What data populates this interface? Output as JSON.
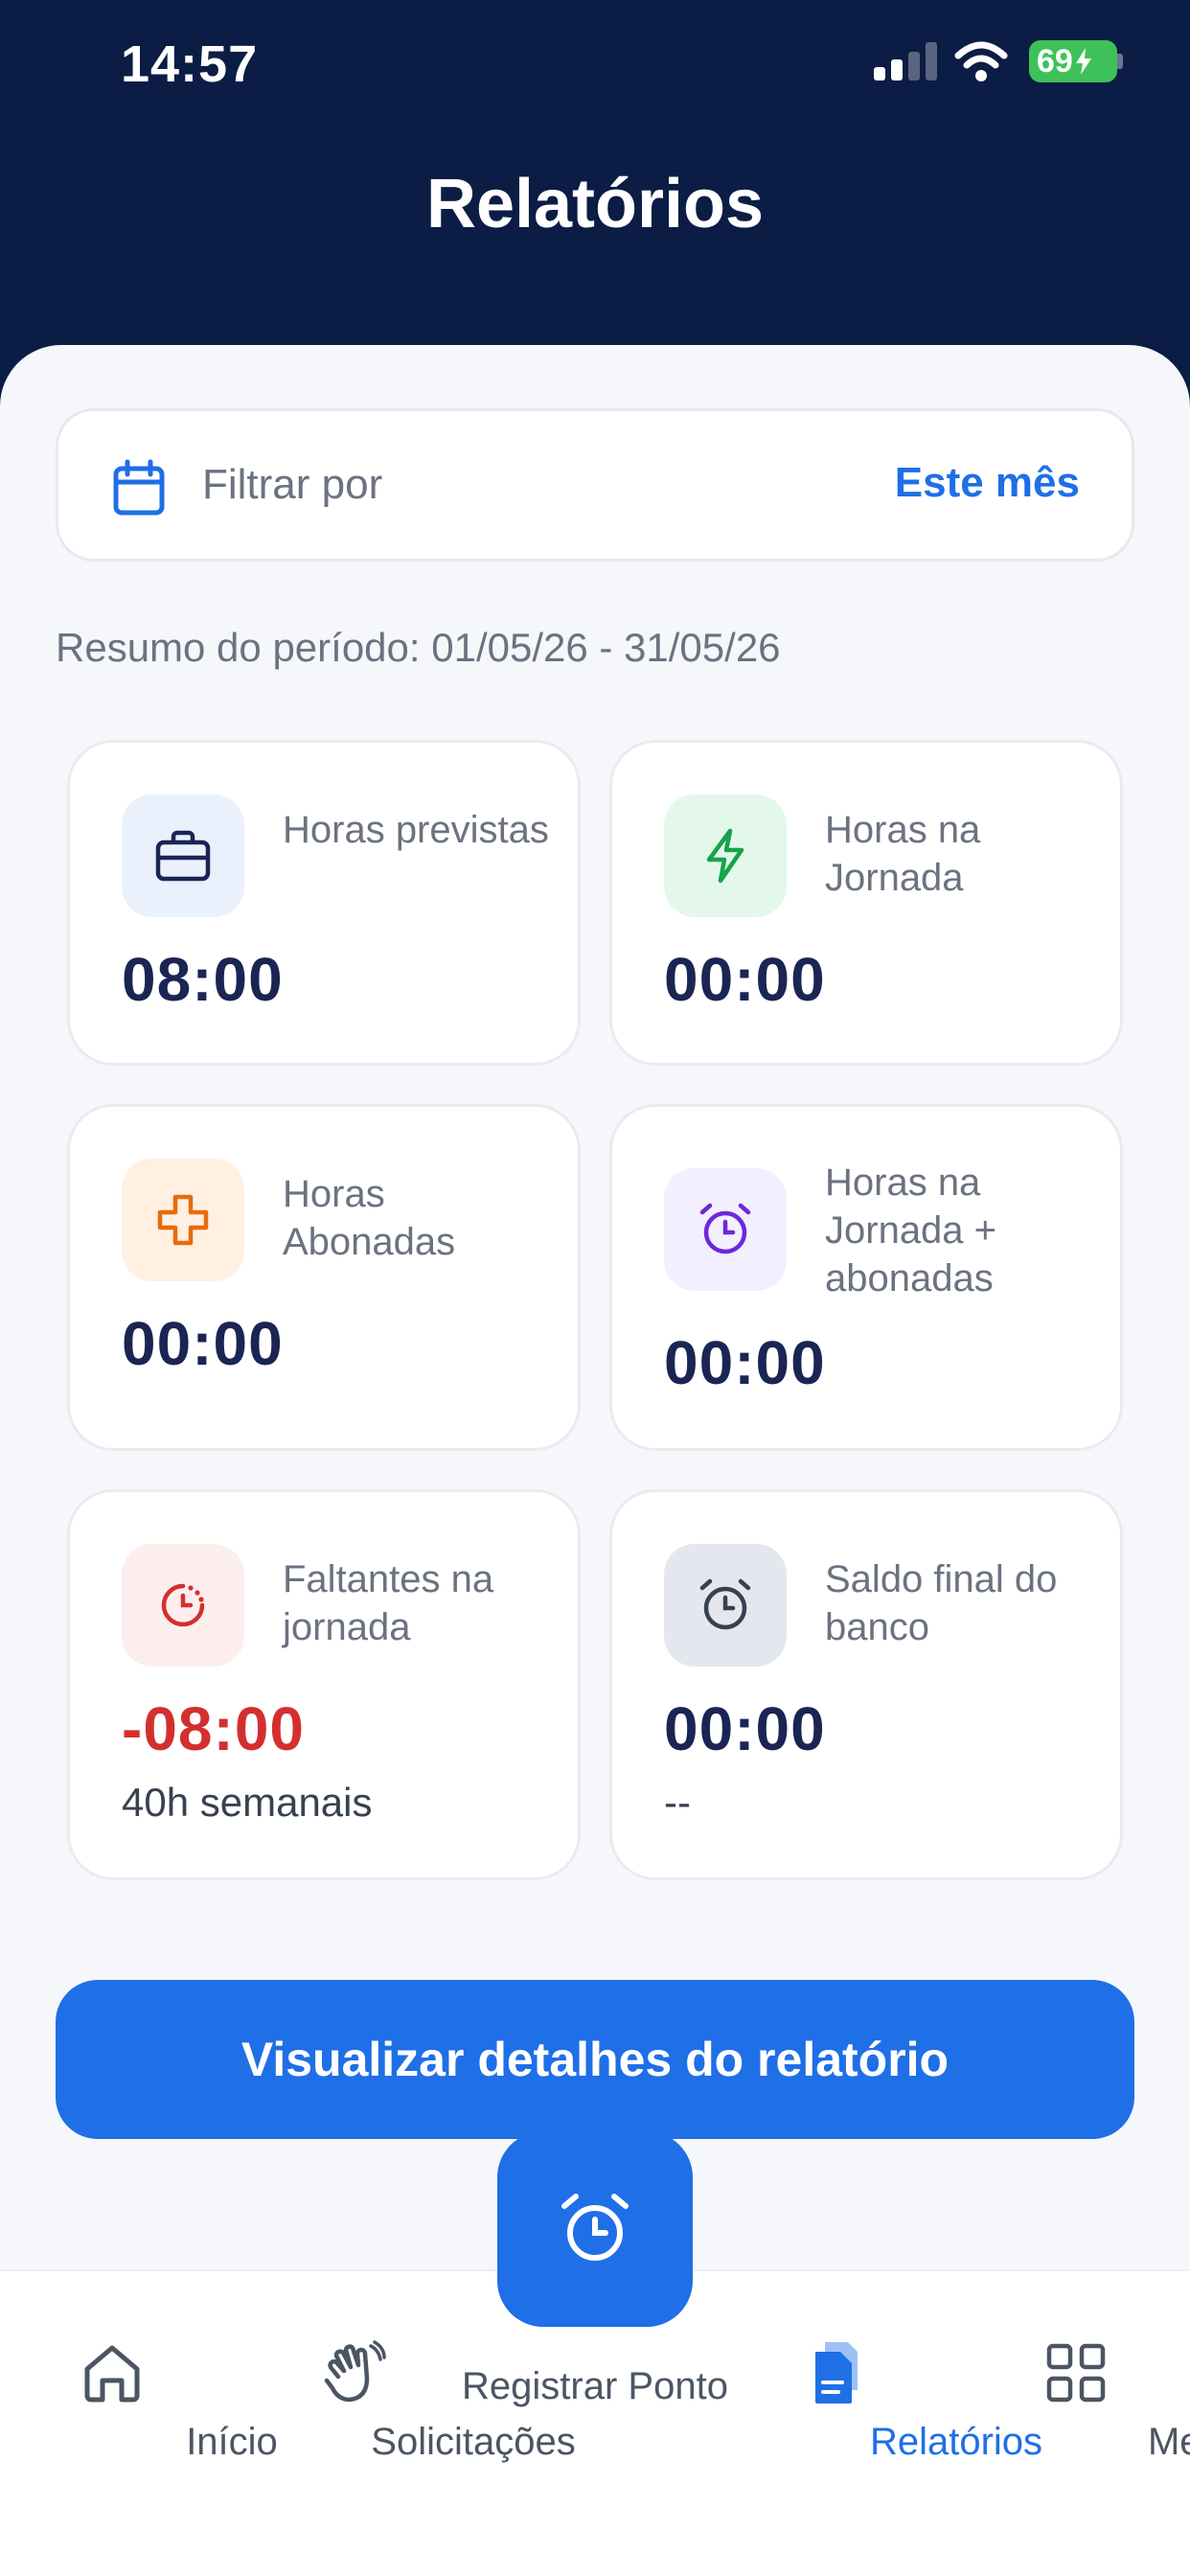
{
  "status_bar": {
    "time": "14:57",
    "battery": "69"
  },
  "header": {
    "title": "Relatórios"
  },
  "filter": {
    "label": "Filtrar por",
    "value": "Este mês"
  },
  "period": {
    "text": "Resumo do período: 01/05/26 - 31/05/26"
  },
  "cards": [
    {
      "label": "Horas previstas",
      "value": "08:00",
      "icon": "briefcase-icon",
      "color": "#1a2553"
    },
    {
      "label": "Horas na Jornada",
      "value": "00:00",
      "icon": "lightning-icon",
      "color": "#1a2553"
    },
    {
      "label": "Horas Abonadas",
      "value": "00:00",
      "icon": "plus-cross-icon",
      "color": "#1a2553"
    },
    {
      "label": "Horas na Jornada + abonadas",
      "value": "00:00",
      "icon": "alarm-clock-icon",
      "color": "#1a2553"
    },
    {
      "label": "Faltantes na jornada",
      "value": "-08:00",
      "sub": "40h semanais",
      "icon": "partial-clock-icon",
      "color": "#d32f2f"
    },
    {
      "label": "Saldo final do banco",
      "value": "00:00",
      "sub": "--",
      "icon": "alarm-clock-icon",
      "color": "#1a2553"
    }
  ],
  "actions": {
    "details_button": "Visualizar detalhes do relatório"
  },
  "nav": {
    "items": [
      {
        "label": "Início",
        "icon": "home-icon"
      },
      {
        "label": "Solicitações",
        "icon": "waving-hand-icon"
      },
      {
        "label": "Registrar Ponto",
        "icon": "alarm-clock-icon"
      },
      {
        "label": "Relatórios",
        "icon": "document-icon",
        "active": true
      },
      {
        "label": "Menu",
        "icon": "grid-icon"
      }
    ]
  },
  "colors": {
    "header_bg": "#0b1d45",
    "accent": "#1f6fe6",
    "negative": "#d32f2f"
  }
}
